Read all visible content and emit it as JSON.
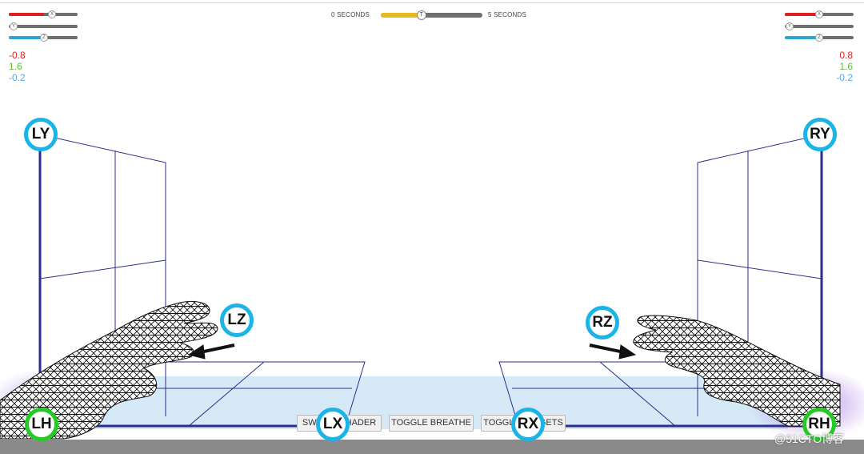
{
  "timeline": {
    "start_label": "0 SECONDS",
    "end_label": "5 SECONDS",
    "knob_label": "T",
    "progress": 0.4
  },
  "left_axes": {
    "x_knob": "X",
    "y_knob": "Y",
    "z_knob": "Z",
    "x_value": "-0.8",
    "y_value": "1.6",
    "z_value": "-0.2"
  },
  "right_axes": {
    "x_knob": "X",
    "y_knob": "Y",
    "z_knob": "Z",
    "x_value": "0.8",
    "y_value": "1.6",
    "z_value": "-0.2"
  },
  "colors": {
    "x_axis": "#e02020",
    "y_axis": "#66bb33",
    "z_axis": "#2aa7d8",
    "marker_blue": "#1ab4e8",
    "marker_green": "#22cc22",
    "grid_line": "#2e2e8a"
  },
  "buttons": {
    "switch_shader": "SWITCH SHADER",
    "toggle_breathe": "TOGGLE BREATHE",
    "toggle_targets": "TOGGLE TARGETS"
  },
  "markers": {
    "ly": "LY",
    "ry": "RY",
    "lz": "LZ",
    "rz": "RZ",
    "lh": "LH",
    "rh": "RH",
    "lx": "LX",
    "rx": "RX"
  },
  "watermark": "@51CTO博客"
}
